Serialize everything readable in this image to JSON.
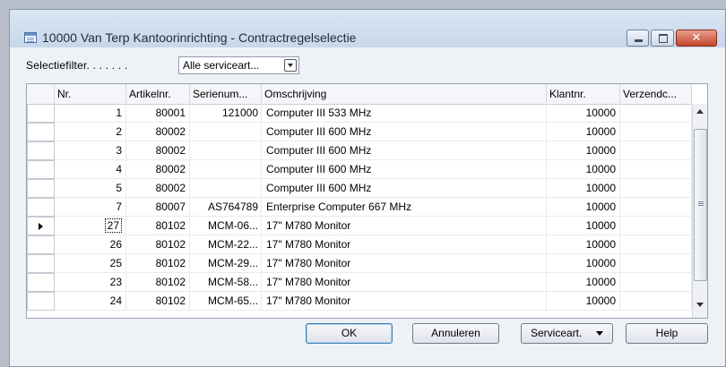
{
  "window": {
    "title": "10000 Van Terp Kantoorinrichting - Contractregelselectie",
    "close_symbol": "✕",
    "icons": [
      "form-icon",
      "minimize-icon",
      "maximize-icon",
      "close-icon"
    ]
  },
  "filter": {
    "label": "Selectiefilter. . . . . . .",
    "value": "Alle serviceart..."
  },
  "table": {
    "columns": [
      "Nr.",
      "Artikelnr.",
      "Serienum...",
      "Omschrijving",
      "Klantnr.",
      "Verzendc..."
    ],
    "current_row_index": 6,
    "rows": [
      {
        "nr": "1",
        "artikel": "80001",
        "serie": "121000",
        "oms": "Computer III 533 MHz",
        "klant": "10000",
        "verzend": ""
      },
      {
        "nr": "2",
        "artikel": "80002",
        "serie": "",
        "oms": "Computer III 600 MHz",
        "klant": "10000",
        "verzend": ""
      },
      {
        "nr": "3",
        "artikel": "80002",
        "serie": "",
        "oms": "Computer III 600 MHz",
        "klant": "10000",
        "verzend": ""
      },
      {
        "nr": "4",
        "artikel": "80002",
        "serie": "",
        "oms": "Computer III 600 MHz",
        "klant": "10000",
        "verzend": ""
      },
      {
        "nr": "5",
        "artikel": "80002",
        "serie": "",
        "oms": "Computer III 600 MHz",
        "klant": "10000",
        "verzend": ""
      },
      {
        "nr": "7",
        "artikel": "80007",
        "serie": "AS764789",
        "oms": "Enterprise Computer 667 MHz",
        "klant": "10000",
        "verzend": ""
      },
      {
        "nr": "27",
        "artikel": "80102",
        "serie": "MCM-06...",
        "oms": "17\" M780 Monitor",
        "klant": "10000",
        "verzend": ""
      },
      {
        "nr": "26",
        "artikel": "80102",
        "serie": "MCM-22...",
        "oms": "17\" M780 Monitor",
        "klant": "10000",
        "verzend": ""
      },
      {
        "nr": "25",
        "artikel": "80102",
        "serie": "MCM-29...",
        "oms": "17\" M780 Monitor",
        "klant": "10000",
        "verzend": ""
      },
      {
        "nr": "23",
        "artikel": "80102",
        "serie": "MCM-58...",
        "oms": "17\" M780 Monitor",
        "klant": "10000",
        "verzend": ""
      },
      {
        "nr": "24",
        "artikel": "80102",
        "serie": "MCM-65...",
        "oms": "17\" M780 Monitor",
        "klant": "10000",
        "verzend": ""
      }
    ]
  },
  "buttons": {
    "ok": "OK",
    "cancel": "Annuleren",
    "service": "Serviceart.",
    "help": "Help"
  }
}
